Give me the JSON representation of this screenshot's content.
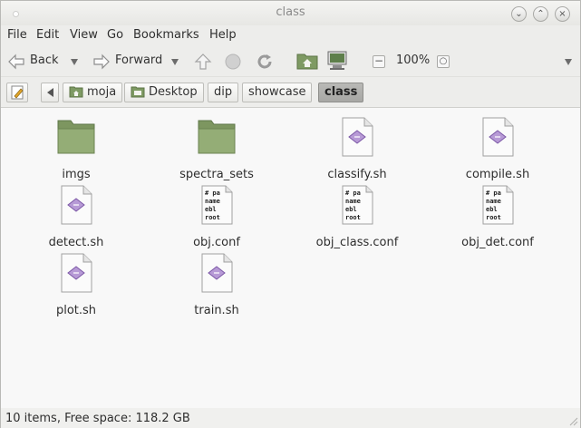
{
  "window": {
    "title": "class"
  },
  "menu": [
    "File",
    "Edit",
    "View",
    "Go",
    "Bookmarks",
    "Help"
  ],
  "toolbar": {
    "back": "Back",
    "forward": "Forward",
    "zoom": "100%"
  },
  "breadcrumb": [
    "moja",
    "Desktop",
    "dip",
    "showcase",
    "class"
  ],
  "files": [
    {
      "name": "imgs",
      "type": "folder"
    },
    {
      "name": "spectra_sets",
      "type": "folder"
    },
    {
      "name": "classify.sh",
      "type": "script"
    },
    {
      "name": "compile.sh",
      "type": "script"
    },
    {
      "name": "detect.sh",
      "type": "script"
    },
    {
      "name": "obj.conf",
      "type": "conf"
    },
    {
      "name": "obj_class.conf",
      "type": "conf"
    },
    {
      "name": "obj_det.conf",
      "type": "conf"
    },
    {
      "name": "plot.sh",
      "type": "script"
    },
    {
      "name": "train.sh",
      "type": "script"
    }
  ],
  "conf_preview": [
    "# pa",
    "name",
    "ebl",
    "root"
  ],
  "status": "10 items, Free space: 118.2 GB",
  "colors": {
    "folder": "#8aa36b",
    "active_crumb": "#b0b0ad",
    "script_icon": "#8a64b6"
  }
}
